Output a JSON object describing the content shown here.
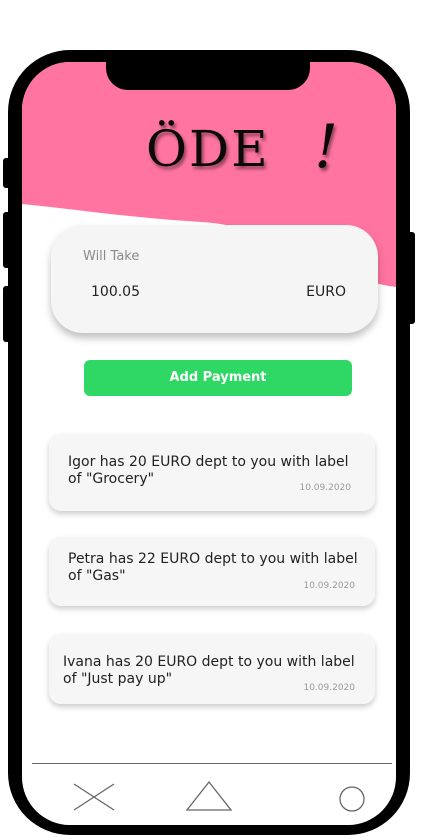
{
  "app": {
    "logo_text": "ÖDE",
    "logo_mark": "!"
  },
  "colors": {
    "header_pink": "#ff74a0",
    "accent_green": "#2fd865",
    "card_bg": "#f6f6f6"
  },
  "summary": {
    "label": "Will Take",
    "amount": "100.05",
    "currency": "EURO"
  },
  "actions": {
    "add_payment_label": "Add Payment"
  },
  "debts": [
    {
      "line1": "Igor has 20 EURO dept to you with label",
      "line2": "of  \"Grocery\"",
      "date": "10.09.2020"
    },
    {
      "line1": "Petra has 22 EURO dept to you with label",
      "line2": "of  \"Gas\"",
      "date": "10.09.2020"
    },
    {
      "line1": "Ivana has 20 EURO dept to you with label",
      "line2": "of  \"Just pay up\"",
      "date": "10.09.2020"
    }
  ],
  "bottom_nav": {
    "items": [
      "close-icon",
      "triangle-icon",
      "circle-icon"
    ]
  }
}
